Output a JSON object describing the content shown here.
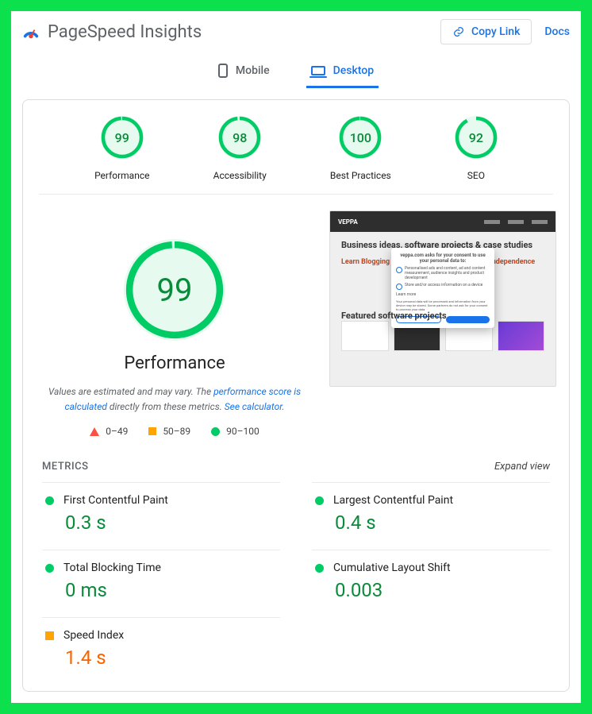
{
  "header": {
    "app_title": "PageSpeed Insights",
    "copy_label": "Copy Link",
    "docs_label": "Docs"
  },
  "tabs": {
    "mobile": "Mobile",
    "desktop": "Desktop"
  },
  "gauges": [
    {
      "score": "99",
      "label": "Performance"
    },
    {
      "score": "98",
      "label": "Accessibility"
    },
    {
      "score": "100",
      "label": "Best Practices"
    },
    {
      "score": "92",
      "label": "SEO"
    }
  ],
  "main": {
    "score": "99",
    "label": "Performance",
    "note_pre": "Values are estimated and may vary. The ",
    "note_link1": "performance score is calculated",
    "note_mid": " directly from these metrics. ",
    "note_link2": "See calculator."
  },
  "legend": {
    "r1": "0–49",
    "r2": "50–89",
    "r3": "90–100"
  },
  "screenshot": {
    "brand": "VEPPA",
    "headline": "Business ideas, software projects & case studies",
    "sub": "Learn Blogging and SaaS to Achieve Financial Independence",
    "featured": "Featured software projects",
    "modal_title": "veppa.com asks for your consent to use your personal data to:"
  },
  "metrics_header": {
    "title": "METRICS",
    "expand": "Expand view"
  },
  "metrics": [
    {
      "name": "First Contentful Paint",
      "value": "0.3 s",
      "status": "good"
    },
    {
      "name": "Largest Contentful Paint",
      "value": "0.4 s",
      "status": "good"
    },
    {
      "name": "Total Blocking Time",
      "value": "0 ms",
      "status": "good"
    },
    {
      "name": "Cumulative Layout Shift",
      "value": "0.003",
      "status": "good"
    },
    {
      "name": "Speed Index",
      "value": "1.4 s",
      "status": "warn"
    }
  ]
}
